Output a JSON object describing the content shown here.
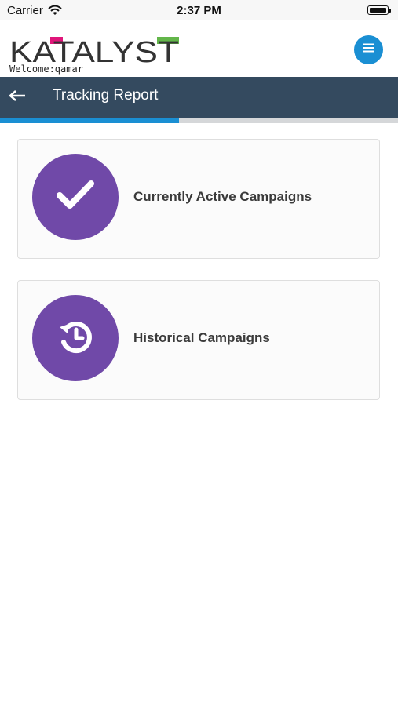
{
  "status_bar": {
    "carrier": "Carrier",
    "time": "2:37 PM"
  },
  "header": {
    "logo_text": "KATALYST",
    "welcome": "Welcome:qamar",
    "menu_icon": "hamburger-menu-icon",
    "colors": {
      "logo_text": "#333333",
      "logo_pink": "#e0167a",
      "logo_green": "#63b64a",
      "menu": "#1a8fd3"
    }
  },
  "toolbar": {
    "title": "Tracking Report",
    "back_icon": "back-arrow-icon",
    "background": "#344a5f"
  },
  "progress": {
    "value_percent": 45
  },
  "cards": [
    {
      "label": "Currently Active Campaigns",
      "icon": "check-icon",
      "color": "#7049a8"
    },
    {
      "label": "Historical Campaigns",
      "icon": "history-icon",
      "color": "#7049a8"
    }
  ]
}
